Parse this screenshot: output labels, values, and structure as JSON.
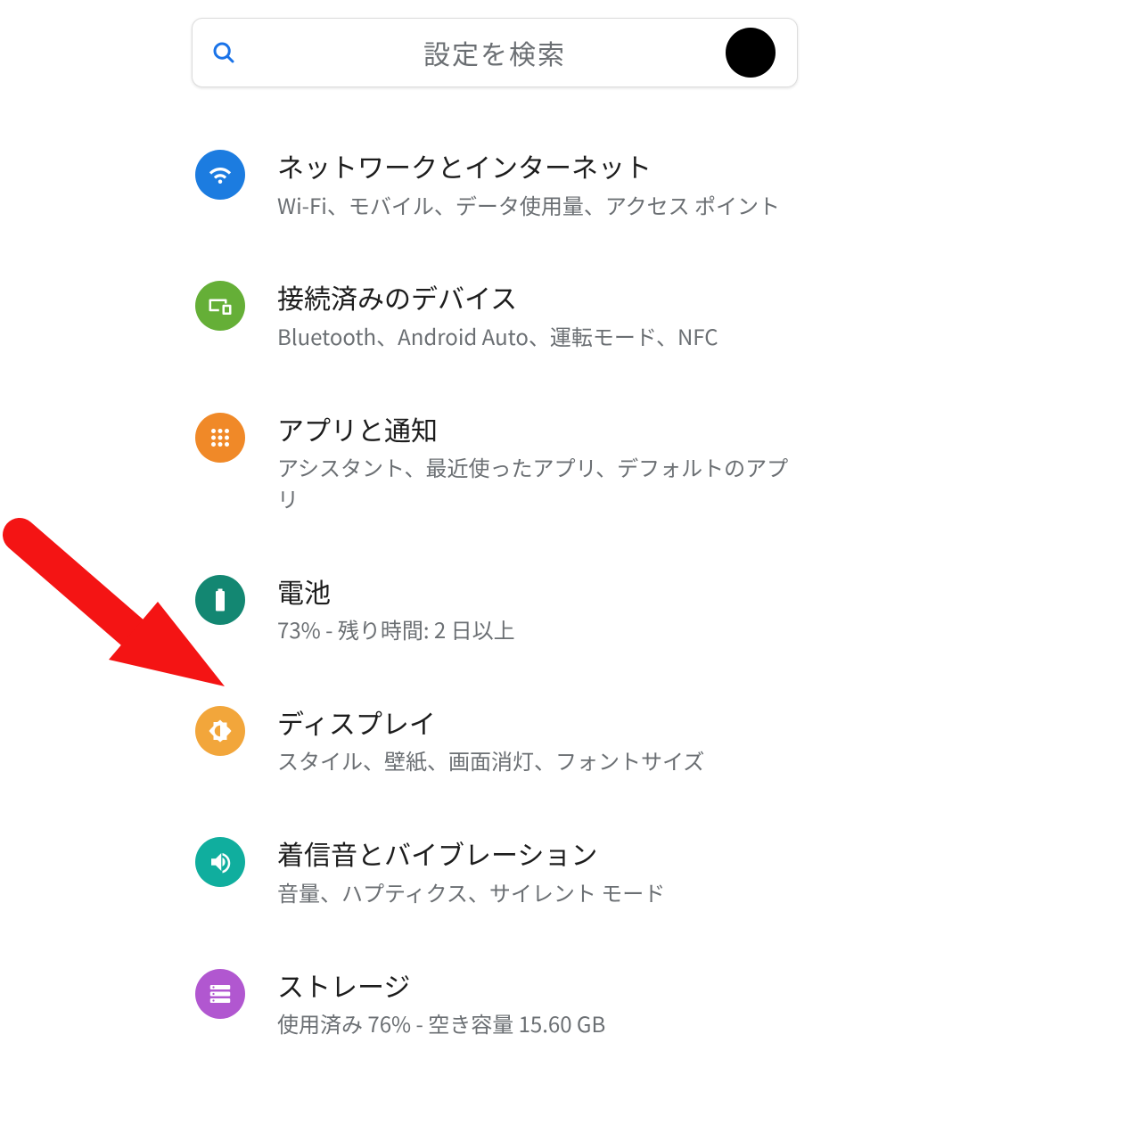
{
  "search": {
    "placeholder": "設定を検索"
  },
  "colors": {
    "network": "#1c7ce0",
    "connected": "#65af37",
    "apps": "#f08928",
    "battery": "#138772",
    "display": "#f2a63b",
    "sound": "#10ae9e",
    "storage": "#b157d0",
    "arrow": "#f41414"
  },
  "items": [
    {
      "icon": "wifi-icon",
      "title": "ネットワークとインターネット",
      "sub": "Wi-Fi、モバイル、データ使用量、アクセス ポイント"
    },
    {
      "icon": "devices-icon",
      "title": "接続済みのデバイス",
      "sub": "Bluetooth、Android Auto、運転モード、NFC"
    },
    {
      "icon": "apps-icon",
      "title": "アプリと通知",
      "sub": "アシスタント、最近使ったアプリ、デフォルトのアプリ"
    },
    {
      "icon": "battery-icon",
      "title": "電池",
      "sub": "73% - 残り時間: 2 日以上"
    },
    {
      "icon": "brightness-icon",
      "title": "ディスプレイ",
      "sub": "スタイル、壁紙、画面消灯、フォントサイズ"
    },
    {
      "icon": "sound-icon",
      "title": "着信音とバイブレーション",
      "sub": "音量、ハプティクス、サイレント モード"
    },
    {
      "icon": "storage-icon",
      "title": "ストレージ",
      "sub": "使用済み 76% - 空き容量 15.60 GB"
    }
  ],
  "annotation": {
    "points_to_item_index": 4
  }
}
